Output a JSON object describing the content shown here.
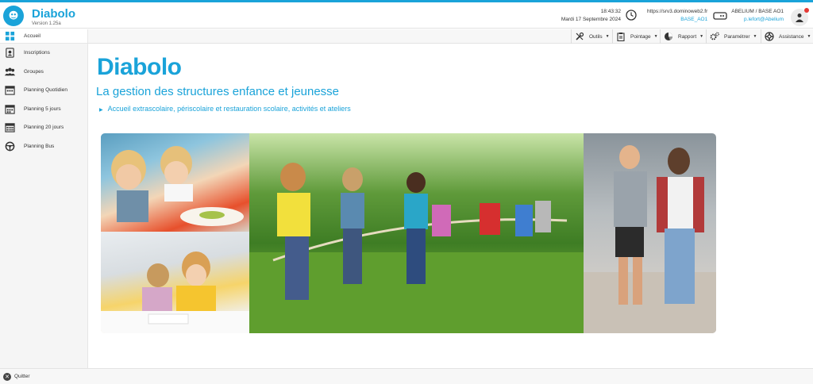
{
  "header": {
    "app_name": "Diabolo",
    "version": "Version 1.25a",
    "time": "18:43:32",
    "date": "Mardi 17 Septembre 2024",
    "server_url": "https://srv3.dominoweb2.fr",
    "server_base": "BASE_AO1",
    "account_org": "ABELIUM / BASE AO1",
    "account_email": "p.lefort@Abelium"
  },
  "sidebar": {
    "items": [
      {
        "label": "Accueil",
        "icon": "grid-icon"
      },
      {
        "label": "Inscriptions",
        "icon": "registration-icon"
      },
      {
        "label": "Groupes",
        "icon": "group-icon"
      },
      {
        "label": "Planning Quotidien",
        "icon": "calendar-day-icon"
      },
      {
        "label": "Planning 5 jours",
        "icon": "calendar-week-icon"
      },
      {
        "label": "Planning 20 jours",
        "icon": "calendar-month-icon"
      },
      {
        "label": "Planning Bus",
        "icon": "steering-wheel-icon"
      }
    ]
  },
  "toolbar": {
    "outils": "Outils",
    "pointage": "Pointage",
    "rapport": "Rapport",
    "parametrer": "Paramétrer",
    "assistance": "Assistance"
  },
  "main": {
    "brand": "Diabolo",
    "tagline": "La gestion des structures enfance et jeunesse",
    "subline": "Accueil extrascolaire, périscolaire et restauration scolaire, activités et ateliers"
  },
  "footer": {
    "quit_label": "Quitter"
  },
  "colors": {
    "accent": "#1aa3d9",
    "notification": "#e53935"
  }
}
